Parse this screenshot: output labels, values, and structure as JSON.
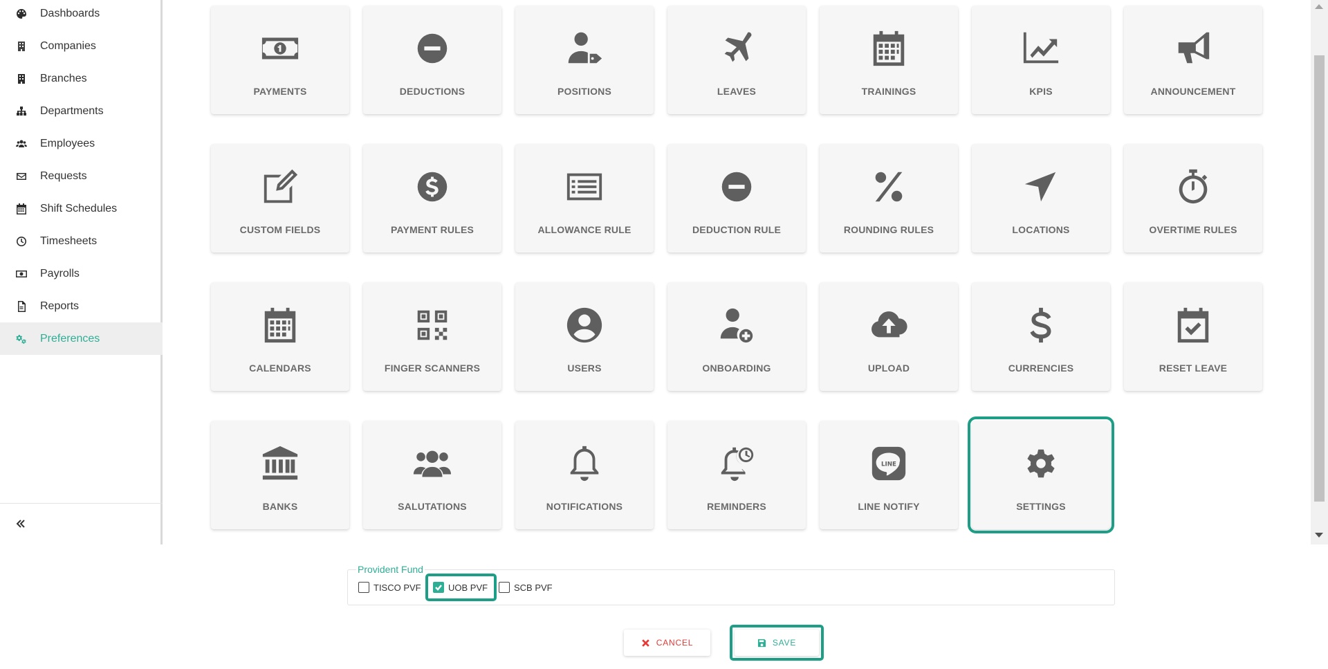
{
  "sidebar": {
    "items": [
      {
        "label": "Dashboards",
        "icon": "palette-icon"
      },
      {
        "label": "Companies",
        "icon": "building-icon"
      },
      {
        "label": "Branches",
        "icon": "building-icon"
      },
      {
        "label": "Departments",
        "icon": "sitemap-icon"
      },
      {
        "label": "Employees",
        "icon": "users-icon"
      },
      {
        "label": "Requests",
        "icon": "envelope-icon"
      },
      {
        "label": "Shift Schedules",
        "icon": "calendar-icon"
      },
      {
        "label": "Timesheets",
        "icon": "clock-icon"
      },
      {
        "label": "Payrolls",
        "icon": "money-icon"
      },
      {
        "label": "Reports",
        "icon": "file-pdf-icon"
      },
      {
        "label": "Preferences",
        "icon": "cogs-icon",
        "active": true
      }
    ],
    "collapse_icon": "double-chevron-left-icon"
  },
  "tiles": [
    {
      "label": "PAYMENTS",
      "icon": "money-bill-icon"
    },
    {
      "label": "DEDUCTIONS",
      "icon": "minus-circle-icon"
    },
    {
      "label": "POSITIONS",
      "icon": "user-tag-icon"
    },
    {
      "label": "LEAVES",
      "icon": "plane-icon"
    },
    {
      "label": "TRAININGS",
      "icon": "calendar-icon"
    },
    {
      "label": "KPIS",
      "icon": "chart-line-icon"
    },
    {
      "label": "ANNOUNCEMENT",
      "icon": "bullhorn-icon"
    },
    {
      "label": "CUSTOM FIELDS",
      "icon": "edit-icon"
    },
    {
      "label": "PAYMENT RULES",
      "icon": "dollar-circle-icon"
    },
    {
      "label": "ALLOWANCE RULE",
      "icon": "list-alt-icon"
    },
    {
      "label": "DEDUCTION RULE",
      "icon": "minus-circle-icon"
    },
    {
      "label": "ROUNDING RULES",
      "icon": "percent-icon"
    },
    {
      "label": "LOCATIONS",
      "icon": "location-arrow-icon"
    },
    {
      "label": "OVERTIME RULES",
      "icon": "stopwatch-icon"
    },
    {
      "label": "CALENDARS",
      "icon": "calendar-icon"
    },
    {
      "label": "FINGER SCANNERS",
      "icon": "qrcode-icon"
    },
    {
      "label": "USERS",
      "icon": "user-circle-icon"
    },
    {
      "label": "ONBOARDING",
      "icon": "user-plus-icon"
    },
    {
      "label": "UPLOAD",
      "icon": "cloud-upload-icon"
    },
    {
      "label": "CURRENCIES",
      "icon": "dollar-sign-icon"
    },
    {
      "label": "RESET LEAVE",
      "icon": "calendar-check-icon"
    },
    {
      "label": "BANKS",
      "icon": "university-icon"
    },
    {
      "label": "SALUTATIONS",
      "icon": "users-icon"
    },
    {
      "label": "NOTIFICATIONS",
      "icon": "bell-icon"
    },
    {
      "label": "REMINDERS",
      "icon": "bell-clock-icon"
    },
    {
      "label": "LINE NOTIFY",
      "icon": "line-icon"
    },
    {
      "label": "SETTINGS",
      "icon": "cog-icon",
      "highlighted": true
    }
  ],
  "line_logo_text": "LINE",
  "provident_fund": {
    "legend": "Provident Fund",
    "options": [
      {
        "label": "TISCO PVF",
        "checked": false
      },
      {
        "label": "UOB PVF",
        "checked": true
      },
      {
        "label": "SCB PVF",
        "checked": false
      }
    ]
  },
  "actions": {
    "cancel_label": "CANCEL",
    "save_label": "SAVE"
  },
  "colors": {
    "accent": "#2fae96",
    "highlight": "#1e9e86",
    "danger": "#e53935",
    "icon": "#5f5f5f"
  }
}
